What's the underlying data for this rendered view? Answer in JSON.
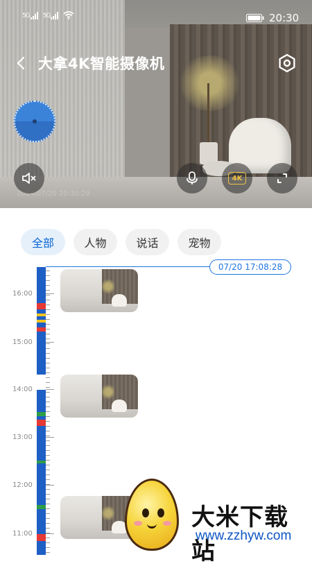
{
  "status_bar": {
    "signal_1": "5G",
    "signal_2": "5G",
    "time": "20:30"
  },
  "header": {
    "title": "大拿4K智能摄像机",
    "back_icon": "chevron-left-icon",
    "settings_icon": "gear-icon"
  },
  "camera": {
    "overlay_text": "2024/07/20 20:30:29",
    "quality_label": "4K",
    "mute_icon": "speaker-muted-icon",
    "mic_icon": "microphone-icon",
    "fullscreen_icon": "fullscreen-icon"
  },
  "filters": {
    "tabs": [
      {
        "label": "全部",
        "active": true
      },
      {
        "label": "人物",
        "active": false
      },
      {
        "label": "说话",
        "active": false
      },
      {
        "label": "宠物",
        "active": false
      }
    ]
  },
  "timeline": {
    "current_time": "07/20 17:08:28",
    "hours": [
      "16:00",
      "15:00",
      "14:00",
      "13:00",
      "12:00",
      "11:00"
    ],
    "accent_color": "#1e5fc6"
  },
  "watermark": {
    "title": "大米下载站",
    "url": "www.zzhyw.com"
  }
}
